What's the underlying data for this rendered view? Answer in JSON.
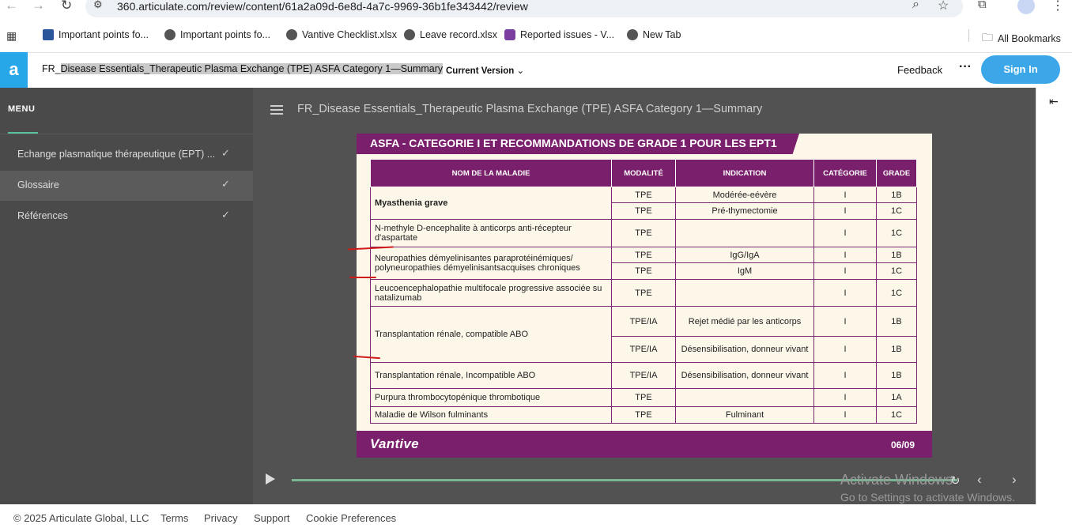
{
  "browser": {
    "url": "360.articulate.com/review/content/61a2a09d-6e8d-4a7c-9969-36b1fe343442/review",
    "bookmarks": [
      {
        "label": "Important points fo...",
        "icon": "word-icon",
        "color": "#2b579a"
      },
      {
        "label": "Important points fo...",
        "icon": "globe-icon",
        "color": "#555555"
      },
      {
        "label": "Vantive Checklist.xlsx",
        "icon": "globe-icon",
        "color": "#555555"
      },
      {
        "label": "Leave record.xlsx",
        "icon": "globe-icon",
        "color": "#555555"
      },
      {
        "label": "Reported issues - V...",
        "icon": "dots-logo-icon",
        "color": "#7b3fa0"
      },
      {
        "label": "New Tab",
        "icon": "globe-icon",
        "color": "#555555"
      }
    ],
    "all_bookmarks": "All Bookmarks"
  },
  "header": {
    "logo": "a",
    "title_prefix": "FR_",
    "title_selected": "Disease Essentials_Therapeutic Plasma Exchange (TPE) ASFA Category 1—Summary",
    "current_version": "Current Version",
    "feedback": "Feedback",
    "sign_in": "Sign In"
  },
  "sidebar": {
    "menu_label": "MENU",
    "items": [
      {
        "label": "Echange plasmatique thérapeutique (EPT) ...",
        "checked": true,
        "selected": false
      },
      {
        "label": "Glossaire",
        "checked": true,
        "selected": true
      },
      {
        "label": "Références",
        "checked": true,
        "selected": false
      }
    ]
  },
  "player": {
    "slide_title": "FR_Disease Essentials_Therapeutic Plasma Exchange (TPE) ASFA Category 1—Summary"
  },
  "slide": {
    "banner": "ASFA - CATEGORIE I ET RECOMMANDATIONS DE GRADE 1 POUR LES EPT1",
    "headers": [
      "NOM DE LA MALADIE",
      "MODALITÉ",
      "INDICATION",
      "CATÉGORIE",
      "GRADE"
    ],
    "diseases": [
      "Myasthenia grave",
      "N-methyle D-encephalite à anticorps anti-récepteur d'aspartate",
      "Neuropathies démyelinisantes paraprotéinémiques/ polyneuropathies démyelinisantsacquises chroniques",
      "Leucoencephalopathie multifocale progressive associée su natalizumab",
      "Transplantation rénale, compatible ABO",
      "Transplantation rénale, Incompatible ABO",
      "Purpura thrombocytopénique thrombotique",
      "Maladie de Wilson fulminants"
    ],
    "rows": [
      [
        "TPE",
        "Modérée-eévère",
        "I",
        "1B"
      ],
      [
        "TPE",
        "Pré-thymectomie",
        "I",
        "1C"
      ],
      [
        "TPE",
        "",
        "I",
        "1C"
      ],
      [
        "TPE",
        "IgG/IgA",
        "I",
        "1B"
      ],
      [
        "TPE",
        "IgM",
        "I",
        "1C"
      ],
      [
        "TPE",
        "",
        "I",
        "1C"
      ],
      [
        "TPE/IA",
        "Rejet médié par les anticorps",
        "I",
        "1B"
      ],
      [
        "TPE/IA",
        "Désensibilisation, donneur vivant",
        "I",
        "1B"
      ],
      [
        "TPE/IA",
        "Désensibilisation, donneur vivant",
        "I",
        "1B"
      ],
      [
        "TPE",
        "",
        "I",
        "1A"
      ],
      [
        "TPE",
        "Fulminant",
        "I",
        "1C"
      ]
    ],
    "footer_logo": "Vantive",
    "page": "06/09"
  },
  "watermark": {
    "line1": "Activate Windows",
    "line2": "Go to Settings to activate Windows."
  },
  "footer": {
    "copyright": "© 2025 Articulate Global, LLC",
    "links": [
      "Terms",
      "Privacy",
      "Support",
      "Cookie Preferences"
    ]
  }
}
